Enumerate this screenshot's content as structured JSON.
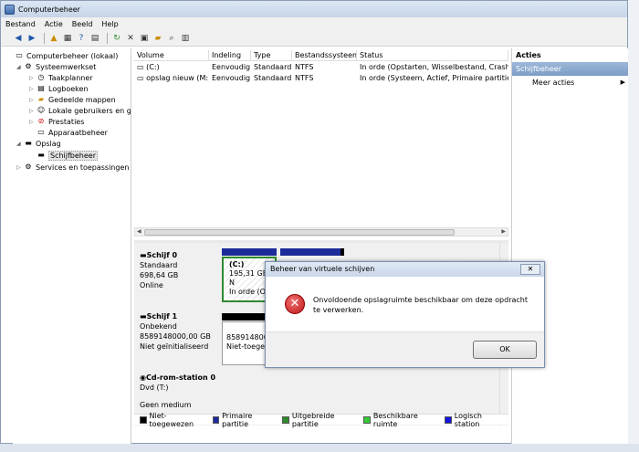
{
  "window": {
    "title": "Computerbeheer"
  },
  "menu": [
    "Bestand",
    "Actie",
    "Beeld",
    "Help"
  ],
  "toolbar_icons": [
    "back-icon",
    "forward-icon",
    "up-icon",
    "console-icon",
    "help-icon",
    "export-icon",
    "refresh-icon",
    "delete-icon",
    "properties-icon",
    "open-icon",
    "search-icon",
    "settings-icon"
  ],
  "tree": {
    "root": "Computerbeheer (lokaal)",
    "items": [
      {
        "label": "Systeemwerkset",
        "level": 1
      },
      {
        "label": "Taakplanner",
        "level": 2
      },
      {
        "label": "Logboeken",
        "level": 2
      },
      {
        "label": "Gedeelde mappen",
        "level": 2
      },
      {
        "label": "Lokale gebruikers en gr",
        "level": 2
      },
      {
        "label": "Prestaties",
        "level": 2
      },
      {
        "label": "Apparaatbeheer",
        "level": 2
      },
      {
        "label": "Opslag",
        "level": 1
      },
      {
        "label": "Schijfbeheer",
        "level": 2
      },
      {
        "label": "Services en toepassingen",
        "level": 1
      }
    ]
  },
  "table": {
    "columns": [
      "Volume",
      "Indeling",
      "Type",
      "Bestandssysteem",
      "Status"
    ],
    "rows": [
      [
        "(C:)",
        "Eenvoudig",
        "Standaard",
        "NTFS",
        "In orde (Opstarten, Wisselbestand, Crashdum"
      ],
      [
        "opslag nieuw (M:)",
        "Eenvoudig",
        "Standaard",
        "NTFS",
        "In orde (Systeem, Actief, Primaire partitie)"
      ]
    ]
  },
  "disks": [
    {
      "name": "Schijf 0",
      "type": "Standaard",
      "size": "698,64 GB",
      "state": "Online",
      "part": {
        "label": "(C:)",
        "size": "195,31 GB N",
        "status": "In orde (Op"
      }
    },
    {
      "name": "Schijf 1",
      "type": "Onbekend",
      "size": "8589148000,00 GB",
      "state": "Niet geïnitialiseerd",
      "part": {
        "size": "8589148000,",
        "status": "Niet-toegew"
      }
    },
    {
      "name": "Cd-rom-station 0",
      "type": "Dvd (T:)",
      "size": "",
      "state": "Geen medium"
    }
  ],
  "legend": [
    {
      "label": "Niet-toegewezen",
      "color": "#000000"
    },
    {
      "label": "Primaire partitie",
      "color": "#1c2b9a"
    },
    {
      "label": "Uitgebreide partitie",
      "color": "#2f8a2f"
    },
    {
      "label": "Beschikbare ruimte",
      "color": "#33cc33"
    },
    {
      "label": "Logisch station",
      "color": "#1414e0"
    }
  ],
  "actions": {
    "header": "Acties",
    "section": "Schijfbeheer",
    "item": "Meer acties"
  },
  "dialog": {
    "title": "Beheer van virtuele schijven",
    "message": "Onvoldoende opslagruimte beschikbaar om deze opdracht te verwerken.",
    "ok": "OK"
  }
}
